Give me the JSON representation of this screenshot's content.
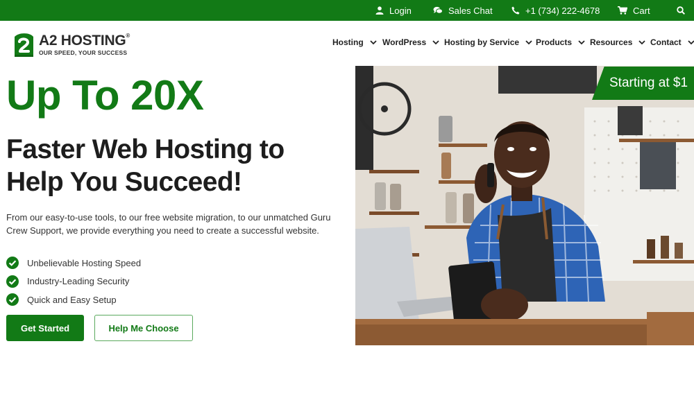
{
  "topbar": {
    "login": "Login",
    "sales_chat": "Sales Chat",
    "phone": "+1 (734) 222-4678",
    "cart": "Cart"
  },
  "brand": {
    "name": "A2 HOSTING",
    "tagline": "OUR SPEED, YOUR SUCCESS",
    "green": "#127a16"
  },
  "nav": {
    "items": [
      {
        "label": "Hosting"
      },
      {
        "label": "WordPress"
      },
      {
        "label": "Hosting by Service"
      },
      {
        "label": "Products"
      },
      {
        "label": "Resources"
      },
      {
        "label": "Contact"
      }
    ]
  },
  "hero": {
    "headline": "Up To 20X",
    "subheadline": "Faster Web Hosting to Help You Succeed!",
    "description": "From our easy-to-use tools, to our free website migration, to our unmatched Guru Crew Support, we provide everything you need to create a successful website.",
    "features": [
      "Unbelievable Hosting Speed",
      "Industry-Leading Security",
      "Quick and Easy Setup"
    ],
    "primary_cta": "Get Started",
    "secondary_cta": "Help Me Choose",
    "price_badge": "Starting at $1"
  }
}
